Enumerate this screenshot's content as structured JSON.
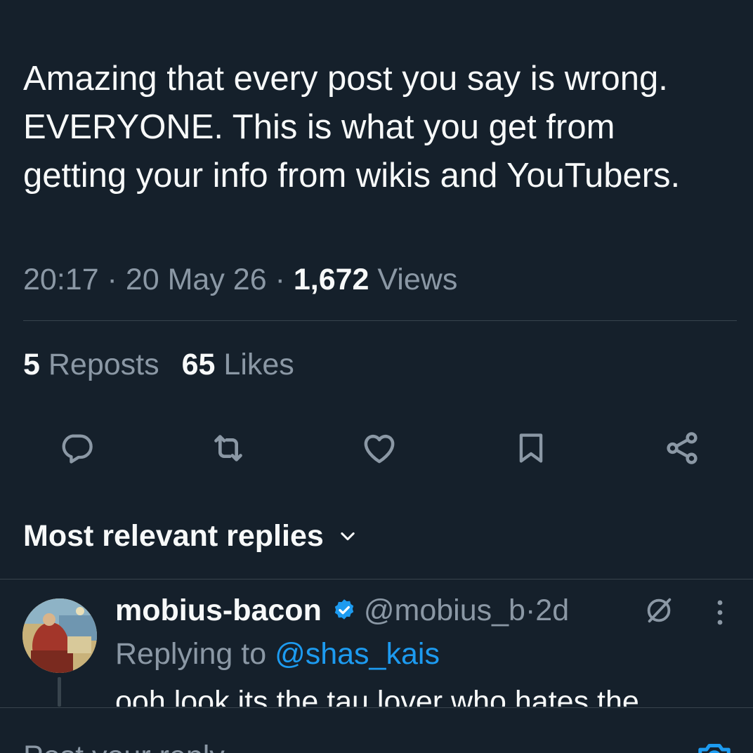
{
  "post": {
    "text": "Amazing that every post you say is wrong. EVERYONE. This is what you get from getting your info from wikis and YouTubers.",
    "time": "20:17",
    "date": "20 May 26",
    "views_count": "1,672",
    "views_label": "Views",
    "sep": " · "
  },
  "stats": {
    "reposts_count": "5",
    "reposts_label": "Reposts",
    "likes_count": "65",
    "likes_label": "Likes"
  },
  "actions": {
    "reply_icon": "reply-icon",
    "repost_icon": "repost-icon",
    "like_icon": "heart-icon",
    "bookmark_icon": "bookmark-icon",
    "share_icon": "share-icon"
  },
  "replies": {
    "sort_label": "Most relevant replies",
    "items": [
      {
        "name": "mobius-bacon",
        "handle": "@mobius_b",
        "age": "2d",
        "replying_prefix": "Replying to ",
        "replying_to": "@shas_kais",
        "text": "ooh look its the tau lover who hates the"
      }
    ]
  },
  "composer": {
    "placeholder": "Post your reply"
  },
  "colors": {
    "background": "#15202b",
    "text": "#f7f9f9",
    "muted": "#8b98a5",
    "accent": "#1d9bf0",
    "divider": "#38444d"
  }
}
